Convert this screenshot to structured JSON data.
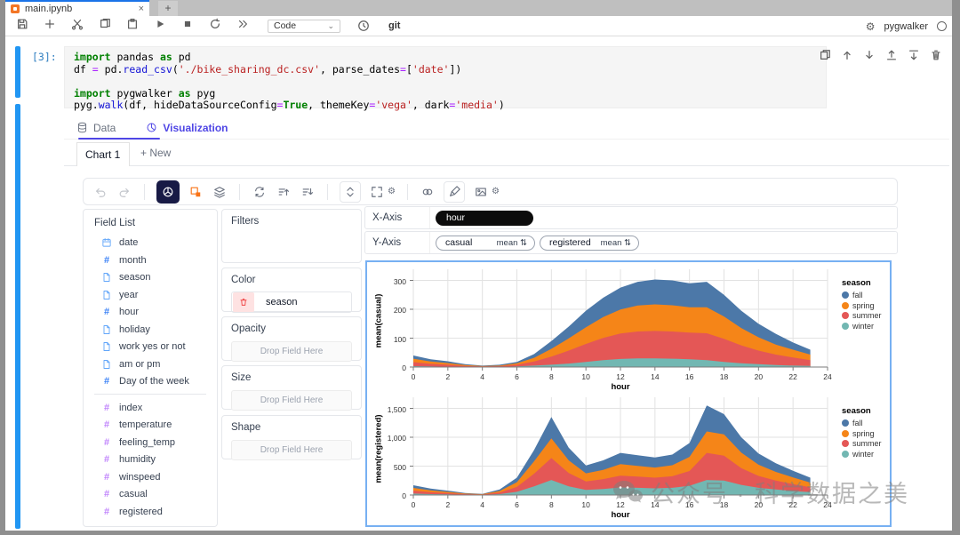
{
  "window": {
    "tab_title": "main.ipynb",
    "close_label": "×",
    "new_tab_label": "+"
  },
  "nb_toolbar": {
    "icons": [
      "save",
      "add",
      "cut",
      "copy",
      "paste",
      "run",
      "stop",
      "restart",
      "run-all"
    ],
    "mode": "Code",
    "mode_caret": "⌄",
    "git_label": "git",
    "kernel_name": "pygwalker"
  },
  "cell": {
    "prompt": "[3]:",
    "actions": [
      "duplicate",
      "move-up",
      "move-down",
      "insert-above",
      "insert-below",
      "delete"
    ],
    "code": [
      [
        {
          "t": "import ",
          "c": "kw"
        },
        {
          "t": "pandas",
          "c": "p"
        },
        {
          "t": " as ",
          "c": "kw"
        },
        {
          "t": "pd",
          "c": "p"
        }
      ],
      [
        {
          "t": "df ",
          "c": "p"
        },
        {
          "t": "= ",
          "c": "op"
        },
        {
          "t": "pd.",
          "c": "p"
        },
        {
          "t": "read_csv",
          "c": "fn"
        },
        {
          "t": "(",
          "c": "p"
        },
        {
          "t": "'./bike_sharing_dc.csv'",
          "c": "str"
        },
        {
          "t": ", parse_dates",
          "c": "p"
        },
        {
          "t": "=",
          "c": "op"
        },
        {
          "t": "[",
          "c": "p"
        },
        {
          "t": "'date'",
          "c": "str"
        },
        {
          "t": "])",
          "c": "p"
        }
      ],
      [],
      [
        {
          "t": "import ",
          "c": "kw"
        },
        {
          "t": "pygwalker",
          "c": "p"
        },
        {
          "t": " as ",
          "c": "kw"
        },
        {
          "t": "pyg",
          "c": "p"
        }
      ],
      [
        {
          "t": "pyg.",
          "c": "p"
        },
        {
          "t": "walk",
          "c": "fn"
        },
        {
          "t": "(df, hideDataSourceConfig",
          "c": "p"
        },
        {
          "t": "=",
          "c": "op"
        },
        {
          "t": "True",
          "c": "kw"
        },
        {
          "t": ", themeKey",
          "c": "p"
        },
        {
          "t": "=",
          "c": "op"
        },
        {
          "t": "'vega'",
          "c": "str"
        },
        {
          "t": ", dark",
          "c": "p"
        },
        {
          "t": "=",
          "c": "op"
        },
        {
          "t": "'media'",
          "c": "str"
        },
        {
          "t": ")",
          "c": "p"
        }
      ]
    ]
  },
  "widget": {
    "tabs": [
      {
        "label": "Data"
      },
      {
        "label": "Visualization"
      }
    ],
    "chart_tabs": {
      "active": "Chart 1",
      "new_label": "+ New"
    },
    "toolbar_icons": [
      "undo",
      "redo",
      "geom-mode",
      "aggregation",
      "layers",
      "refresh",
      "sort-asc",
      "sort-desc",
      "height",
      "resize",
      "settings",
      "limit",
      "brush",
      "export",
      "config"
    ],
    "panels": {
      "field_list_title": "Field List",
      "fields": [
        {
          "name": "date",
          "type": "date"
        },
        {
          "name": "month",
          "type": "dim-num"
        },
        {
          "name": "season",
          "type": "text"
        },
        {
          "name": "year",
          "type": "text"
        },
        {
          "name": "hour",
          "type": "dim-num"
        },
        {
          "name": "holiday",
          "type": "text"
        },
        {
          "name": "work yes or not",
          "type": "text"
        },
        {
          "name": "am or pm",
          "type": "text"
        },
        {
          "name": "Day of the week",
          "type": "dim-num"
        },
        {
          "name": "index",
          "type": "measure"
        },
        {
          "name": "temperature",
          "type": "measure"
        },
        {
          "name": "feeling_temp",
          "type": "measure"
        },
        {
          "name": "humidity",
          "type": "measure"
        },
        {
          "name": "winspeed",
          "type": "measure"
        },
        {
          "name": "casual",
          "type": "measure"
        },
        {
          "name": "registered",
          "type": "measure"
        }
      ],
      "filters_title": "Filters",
      "color_title": "Color",
      "color_value": "season",
      "opacity_title": "Opacity",
      "size_title": "Size",
      "shape_title": "Shape",
      "drop_placeholder": "Drop Field Here"
    },
    "encodings": {
      "x_label": "X-Axis",
      "x_value": "hour",
      "y_label": "Y-Axis",
      "y_pills": [
        {
          "field": "casual",
          "agg": "mean",
          "sort_glyph": "⇅"
        },
        {
          "field": "registered",
          "agg": "mean",
          "sort_glyph": "⇅"
        }
      ]
    }
  },
  "watermark": {
    "text": "公众号 · 科学数据之美"
  },
  "chart_data": [
    {
      "type": "area",
      "stacked": true,
      "xlabel": "hour",
      "ylabel": "mean(casual)",
      "xlim": [
        0,
        24
      ],
      "ylim": [
        0,
        320
      ],
      "xticks": [
        0,
        2,
        4,
        6,
        8,
        10,
        12,
        14,
        16,
        18,
        20,
        22,
        24
      ],
      "yticks": [
        0,
        100,
        200,
        300
      ],
      "ytick_labels": [
        "0",
        "100",
        "200",
        "300"
      ],
      "grid": true,
      "legend_position": "right",
      "legend_title": "season",
      "x": [
        0,
        1,
        2,
        3,
        4,
        5,
        6,
        7,
        8,
        9,
        10,
        11,
        12,
        13,
        14,
        15,
        16,
        17,
        18,
        19,
        20,
        21,
        22,
        23
      ],
      "stack_order_bottom_to_top": [
        "winter",
        "summer",
        "spring",
        "fall"
      ],
      "series": [
        {
          "name": "fall",
          "color": "#4c78a8",
          "values": [
            11,
            8,
            6,
            3,
            1.5,
            3,
            5,
            13,
            27,
            41,
            57,
            67,
            76,
            82,
            86,
            86,
            83,
            88,
            75,
            60,
            47,
            37,
            25,
            17
          ]
        },
        {
          "name": "spring",
          "color": "#f58518",
          "values": [
            12,
            8,
            6,
            3,
            1.5,
            2,
            5,
            13,
            27,
            42,
            58,
            72,
            83,
            90,
            92,
            91,
            88,
            90,
            77,
            60,
            46,
            35,
            27,
            19
          ]
        },
        {
          "name": "summer",
          "color": "#e45756",
          "values": [
            14,
            9,
            7,
            3,
            1.5,
            2,
            6,
            14,
            28,
            45,
            62,
            77,
            88,
            93,
            95,
            94,
            92,
            93,
            80,
            62,
            47,
            36,
            28,
            20
          ]
        },
        {
          "name": "winter",
          "color": "#72b7b2",
          "values": [
            3,
            2,
            1,
            1,
            0.5,
            1,
            2,
            5,
            8,
            12,
            18,
            24,
            28,
            30,
            30,
            29,
            27,
            24,
            18,
            13,
            10,
            7,
            5,
            4
          ]
        }
      ]
    },
    {
      "type": "area",
      "stacked": true,
      "xlabel": "hour",
      "ylabel": "mean(registered)",
      "xlim": [
        0,
        24
      ],
      "ylim": [
        0,
        1600
      ],
      "xticks": [
        0,
        2,
        4,
        6,
        8,
        10,
        12,
        14,
        16,
        18,
        20,
        22,
        24
      ],
      "yticks": [
        0,
        500,
        1000,
        1500
      ],
      "ytick_labels": [
        "0",
        "500",
        "1,000",
        "1,500"
      ],
      "grid": true,
      "legend_position": "right",
      "legend_title": "season",
      "x": [
        0,
        1,
        2,
        3,
        4,
        5,
        6,
        7,
        8,
        9,
        10,
        11,
        12,
        13,
        14,
        15,
        16,
        17,
        18,
        19,
        20,
        21,
        22,
        23
      ],
      "stack_order_bottom_to_top": [
        "winter",
        "summer",
        "spring",
        "fall"
      ],
      "series": [
        {
          "name": "fall",
          "color": "#4c78a8",
          "values": [
            47,
            30,
            21,
            10,
            5,
            25,
            78,
            195,
            370,
            220,
            135,
            165,
            195,
            185,
            175,
            185,
            240,
            450,
            350,
            265,
            195,
            150,
            115,
            85
          ]
        },
        {
          "name": "spring",
          "color": "#f58518",
          "values": [
            48,
            32,
            22,
            10,
            6,
            27,
            82,
            215,
            340,
            220,
            140,
            160,
            200,
            185,
            175,
            190,
            245,
            370,
            370,
            270,
            195,
            150,
            115,
            80
          ]
        },
        {
          "name": "summer",
          "color": "#e45756",
          "values": [
            50,
            33,
            22,
            10,
            6,
            28,
            85,
            220,
            380,
            230,
            145,
            170,
            205,
            195,
            185,
            200,
            255,
            470,
            430,
            290,
            205,
            155,
            120,
            85
          ]
        },
        {
          "name": "winter",
          "color": "#72b7b2",
          "values": [
            25,
            15,
            10,
            5,
            3,
            15,
            55,
            150,
            260,
            150,
            90,
            105,
            130,
            125,
            115,
            125,
            160,
            260,
            250,
            175,
            125,
            95,
            70,
            50
          ]
        }
      ]
    }
  ]
}
